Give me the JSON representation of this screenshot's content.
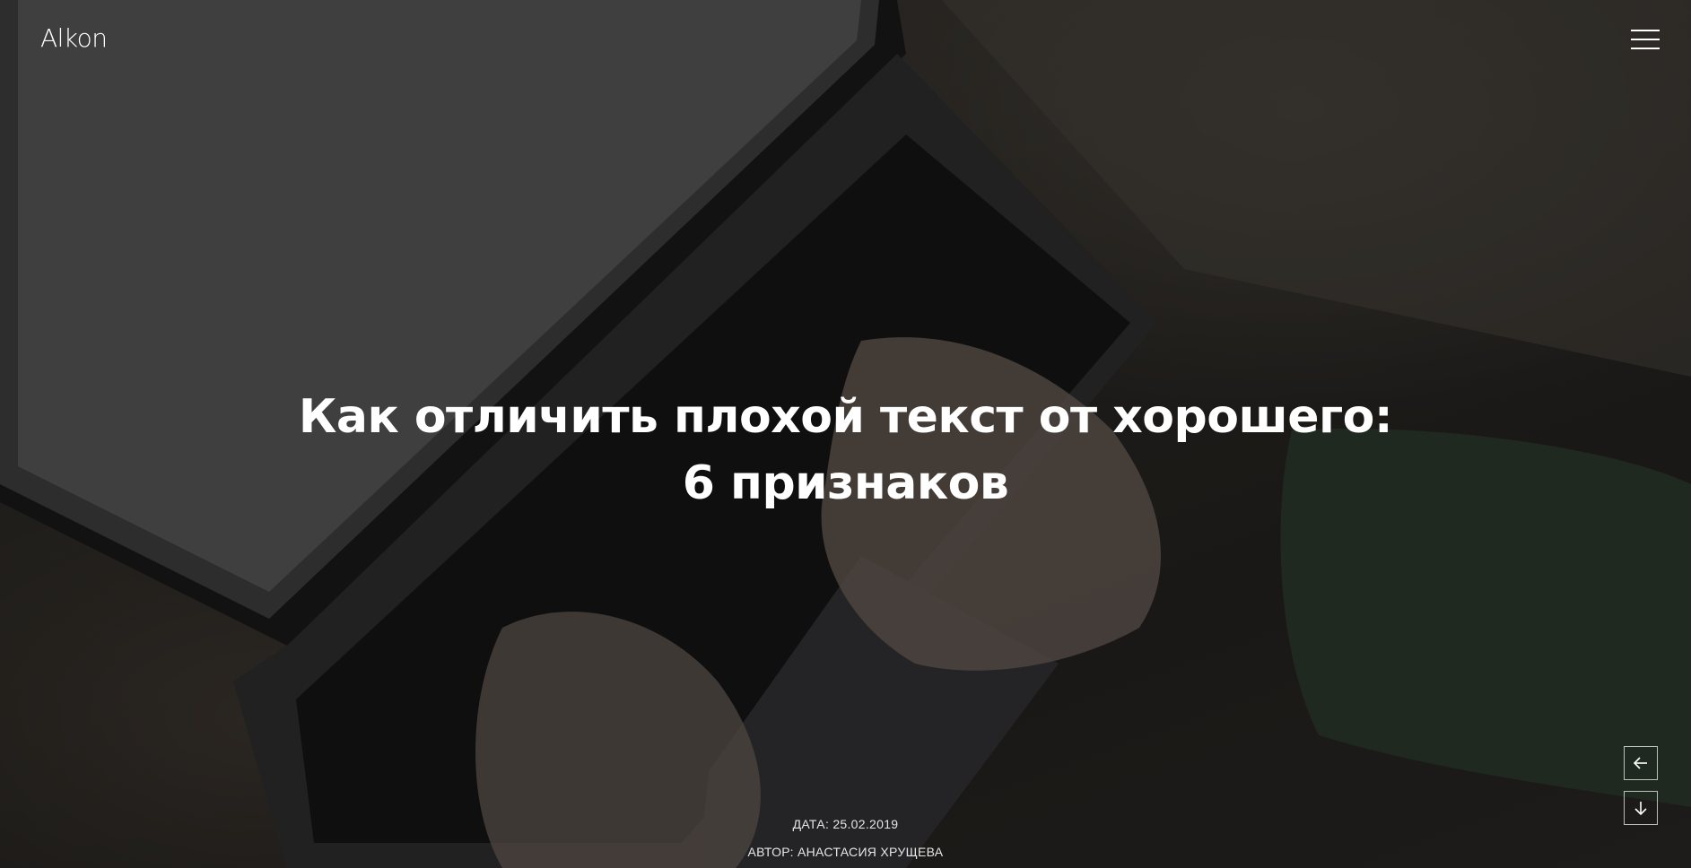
{
  "header": {
    "logo": "Alkon",
    "menu_icon": "hamburger-menu-icon"
  },
  "article": {
    "title_line1": "Как отличить плохой текст от хорошего:",
    "title_line2": "6 признаков",
    "date": "ДАТА: 25.02.2019",
    "author": "АВТОР: АНАСТАСИЯ ХРУЩЕВА"
  },
  "controls": {
    "prev_icon": "arrow-left-icon",
    "down_icon": "arrow-down-icon"
  },
  "colors": {
    "text": "#ffffff",
    "overlay": "#000000"
  }
}
